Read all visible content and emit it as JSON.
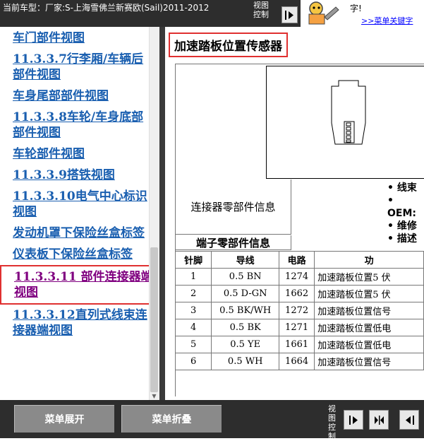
{
  "header": {
    "current_model": "当前车型：厂家:S-上海雪佛兰新赛欧(Sail)2011-2012",
    "view_control": "视图控制"
  },
  "ad": {
    "text": "字!",
    "link": ">>菜单关键字"
  },
  "sidebar": {
    "items": [
      {
        "label": "车门部件视图"
      },
      {
        "label": "11.3.3.7行李厢/车辆后部件视图"
      },
      {
        "label": "车身尾部部件视图"
      },
      {
        "label": "11.3.3.8车轮/车身底部部件视图"
      },
      {
        "label": "车轮部件视图"
      },
      {
        "label": "11.3.3.9搭铁视图"
      },
      {
        "label": "11.3.3.10电气中心标识视图"
      },
      {
        "label": "发动机罩下保险丝盒标签"
      },
      {
        "label": "仪表板下保险丝盒标签"
      },
      {
        "label": "11.3.3.11 部件连接器端视图"
      },
      {
        "label": "11.3.3.12直列式线束连接器端视图"
      }
    ]
  },
  "main": {
    "title": "加速踏板位置传感器",
    "connector_info_label": "连接器零部件信息",
    "connector_info_bullets": [
      "线束",
      "OEM:",
      "维修",
      "描述"
    ],
    "terminal_info_label": "端子零部件信息",
    "columns": [
      "针脚",
      "导线",
      "电路",
      "功"
    ],
    "rows": [
      [
        "1",
        "0.5 BN",
        "1274",
        "加速踏板位置5 伏"
      ],
      [
        "2",
        "0.5 D-GN",
        "1662",
        "加速踏板位置5 伏"
      ],
      [
        "3",
        "0.5 BK/WH",
        "1272",
        "加速踏板位置信号"
      ],
      [
        "4",
        "0.5 BK",
        "1271",
        "加速踏板位置低电"
      ],
      [
        "5",
        "0.5 YE",
        "1661",
        "加速踏板位置低电"
      ],
      [
        "6",
        "0.5 WH",
        "1664",
        "加速踏板位置信号"
      ]
    ]
  },
  "bottom": {
    "expand_label": "菜单展开",
    "collapse_label": "菜单折叠",
    "view_control": "视图控制"
  }
}
